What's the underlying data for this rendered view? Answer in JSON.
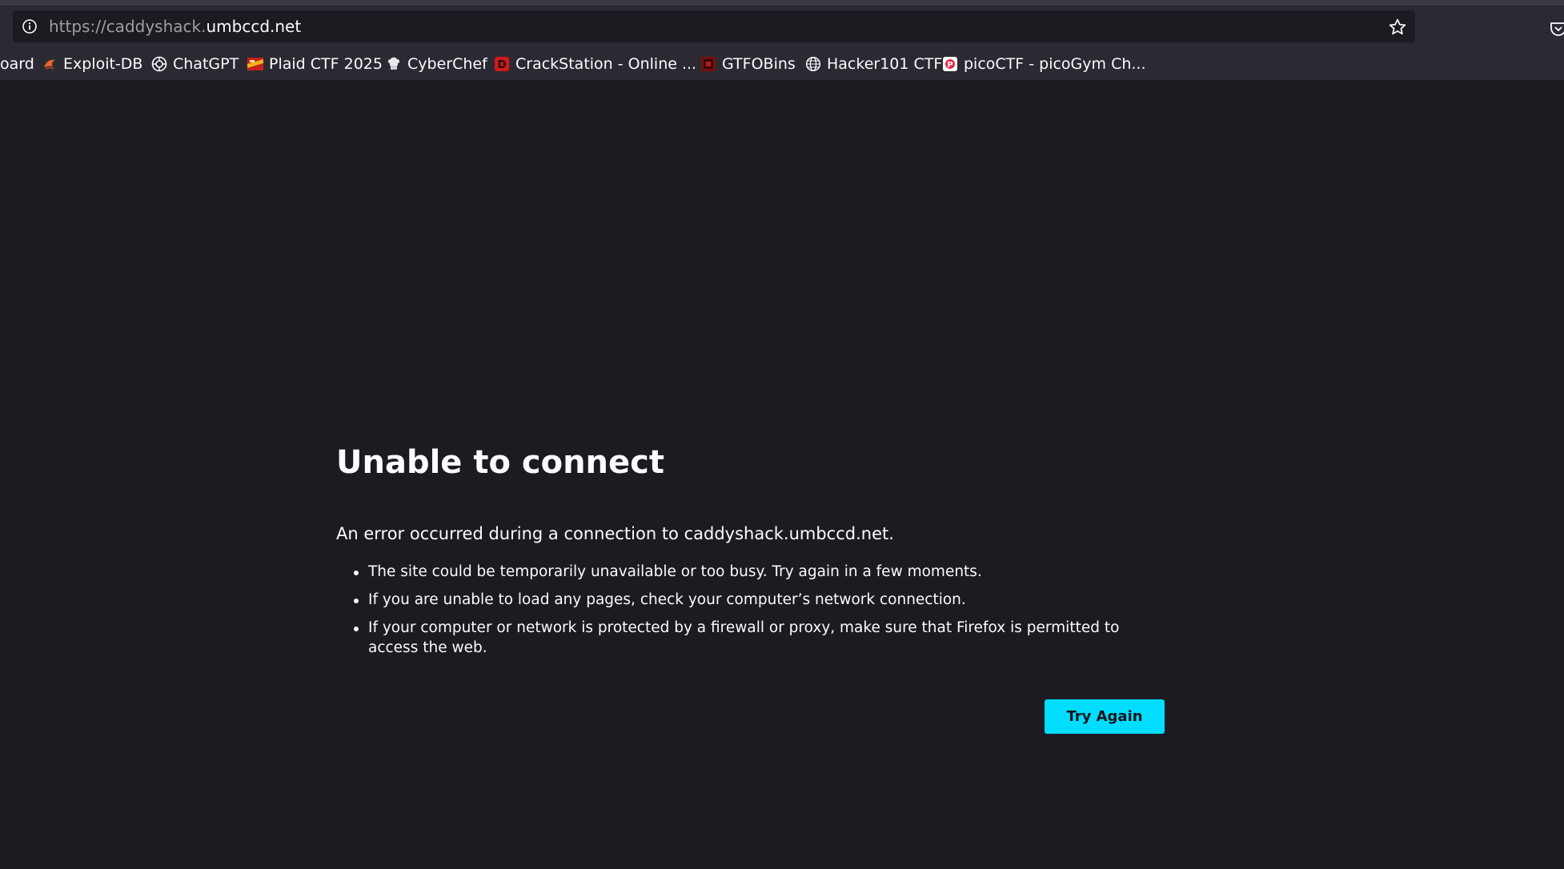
{
  "address_bar": {
    "url_scheme_and_sub": "https://caddyshack.",
    "url_domain": "umbccd.net"
  },
  "bookmarks": [
    {
      "label": "oard",
      "icon": "none"
    },
    {
      "label": "Exploit-DB",
      "icon": "exploit-db-icon"
    },
    {
      "label": "ChatGPT",
      "icon": "chatgpt-icon"
    },
    {
      "label": "Plaid CTF 2025",
      "icon": "plaid-ctf-icon"
    },
    {
      "label": "CyberChef",
      "icon": "cyberchef-icon"
    },
    {
      "label": "CrackStation - Online ...",
      "icon": "crackstation-icon"
    },
    {
      "label": "GTFOBins",
      "icon": "gtfobins-icon"
    },
    {
      "label": "Hacker101 CTF",
      "icon": "globe-icon"
    },
    {
      "label": "picoCTF - picoGym Ch...",
      "icon": "picoctf-icon"
    }
  ],
  "error_page": {
    "title": "Unable to connect",
    "description": "An error occurred during a connection to caddyshack.umbccd.net.",
    "suggestions": [
      "The site could be temporarily unavailable or too busy. Try again in a few moments.",
      "If you are unable to load any pages, check your computer’s network connection.",
      "If your computer or network is protected by a firewall or proxy, make sure that Firefox is permitted to access the web."
    ],
    "try_again_label": "Try Again"
  },
  "colors": {
    "page_background": "#1c1b22",
    "toolbar_background": "#2b2a33",
    "accent_button": "#00ddff"
  }
}
